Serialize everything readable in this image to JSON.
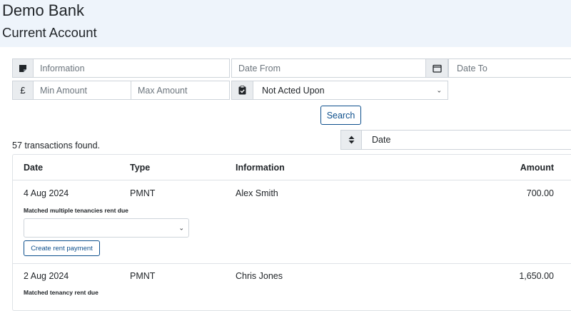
{
  "header": {
    "bank_name": "Demo Bank",
    "account_name": "Current Account"
  },
  "filters": {
    "information_placeholder": "Information",
    "date_from_placeholder": "Date From",
    "date_to_placeholder": "Date To",
    "currency_symbol": "£",
    "min_amount_placeholder": "Min Amount",
    "max_amount_placeholder": "Max Amount",
    "status_selected": "Not Acted Upon",
    "search_label": "Search",
    "sort_selected": "Date"
  },
  "results": {
    "count_text": "57 transactions found."
  },
  "table": {
    "columns": [
      "Date",
      "Type",
      "Information",
      "Amount"
    ],
    "rows": [
      {
        "date": "4 Aug 2024",
        "type": "PMNT",
        "information": "Alex Smith",
        "amount": "700.00",
        "match_label": "Matched multiple tenancies rent due",
        "action_label": "Create rent payment"
      },
      {
        "date": "2 Aug 2024",
        "type": "PMNT",
        "information": "Chris Jones",
        "amount": "1,650.00",
        "match_label": "Matched tenancy rent due"
      }
    ]
  },
  "colors": {
    "header_bg": "#eef4fb",
    "accent": "#0d4f8c",
    "border": "#ced4da"
  }
}
